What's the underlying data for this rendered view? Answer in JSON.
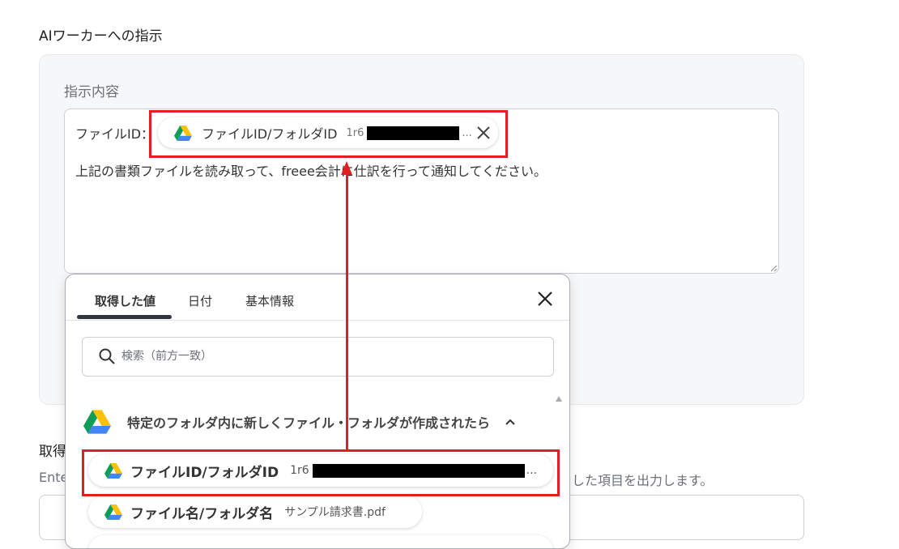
{
  "section_title": "AIワーカーへの指示",
  "instruction": {
    "label": "指示内容",
    "prefix": "ファイルID：",
    "chip": {
      "label": "ファイルID/フォルダID",
      "value": "1r6",
      "ellipsis": "..."
    },
    "body": "上記の書類ファイルを読み取って、freee会計に仕訳を行って通知してください。"
  },
  "background_section": {
    "title": "取得",
    "desc_left": "Ente",
    "desc_right": "した項目を出力します。"
  },
  "popup": {
    "tabs": [
      "取得した値",
      "日付",
      "基本情報"
    ],
    "search_placeholder": "検索（前方一致）",
    "group": {
      "label": "特定のフォルダ内に新しくファイル・フォルダが作成されたら"
    },
    "items": [
      {
        "label": "ファイルID/フォルダID",
        "value": "1r6",
        "ellipsis": "..."
      },
      {
        "label": "ファイル名/フォルダ名",
        "value": "サンプル請求書.pdf"
      }
    ]
  },
  "colors": {
    "highlight": "#e02020",
    "panel_bg": "#f6f7f8",
    "drive_green": "#0f9d58",
    "drive_yellow": "#ffc107",
    "drive_blue": "#4285f4"
  },
  "icons": [
    "google-drive-icon",
    "close-icon",
    "search-icon",
    "chevron-up-icon"
  ]
}
